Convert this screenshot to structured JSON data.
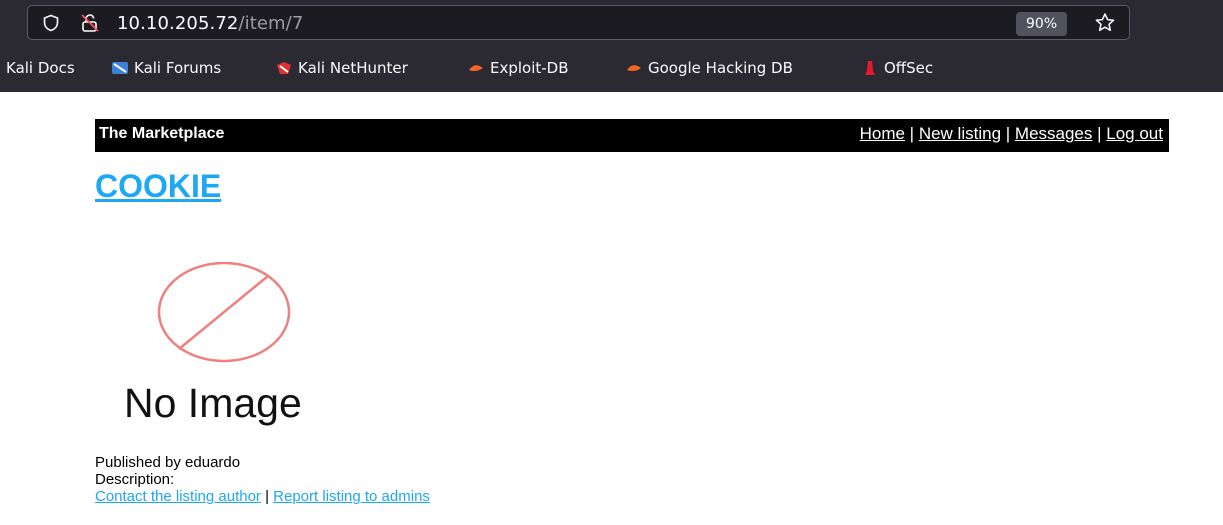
{
  "browser": {
    "url_host": "10.10.205.72",
    "url_path": "/item/7",
    "zoom": "90%",
    "bookmarks": [
      {
        "label": "Kali Docs",
        "icon": "kali-docs-icon"
      },
      {
        "label": "Kali Forums",
        "icon": "kali-forums-icon"
      },
      {
        "label": "Kali NetHunter",
        "icon": "nethunter-icon"
      },
      {
        "label": "Exploit-DB",
        "icon": "exploit-db-icon"
      },
      {
        "label": "Google Hacking DB",
        "icon": "ghdb-icon"
      },
      {
        "label": "OffSec",
        "icon": "offsec-icon"
      }
    ]
  },
  "site": {
    "brand": "The Marketplace",
    "nav": {
      "home": "Home",
      "new_listing": "New listing",
      "messages": "Messages",
      "logout": "Log out",
      "separator": " | "
    }
  },
  "listing": {
    "title": "COOKIE",
    "image_text": "No Image",
    "published_by": "Published by eduardo",
    "description_label": "Description:",
    "contact_link": "Contact the listing author",
    "report_link": "Report listing to admins",
    "links_separator": " | "
  },
  "colors": {
    "link": "#1ea7f5",
    "navbar_bg": "#000000",
    "placeholder_stroke": "#f08080"
  }
}
